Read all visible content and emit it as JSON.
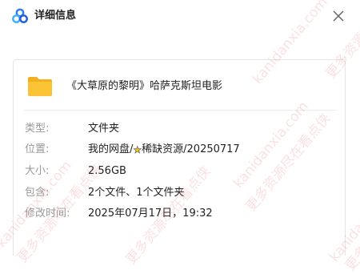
{
  "dialog": {
    "title": "详细信息",
    "close_icon": "close-icon",
    "app_icon": "baidu-netdisk-logo-icon"
  },
  "file": {
    "icon": "folder-icon",
    "name": "《大草原的黎明》哈萨克斯坦电影"
  },
  "details": {
    "type_label": "类型:",
    "type_value": "文件夹",
    "location_label": "位置:",
    "location_prefix": "我的网盘/",
    "location_star": "★",
    "location_suffix": "稀缺资源/20250717",
    "size_label": "大小:",
    "size_value": "2.56GB",
    "contains_label": "包含:",
    "contains_value": "2个文件、1个文件夹",
    "modified_label": "修改时间:",
    "modified_value": "2025年07月17日，19:32"
  },
  "watermark": {
    "line1": "kanidanxia.com",
    "line2": "更多资源尽在看点侠",
    "color": "#e67878"
  },
  "colors": {
    "folder": "#f9c333",
    "label": "#9a9a9a",
    "text": "#222222",
    "star": "#f5c518"
  }
}
